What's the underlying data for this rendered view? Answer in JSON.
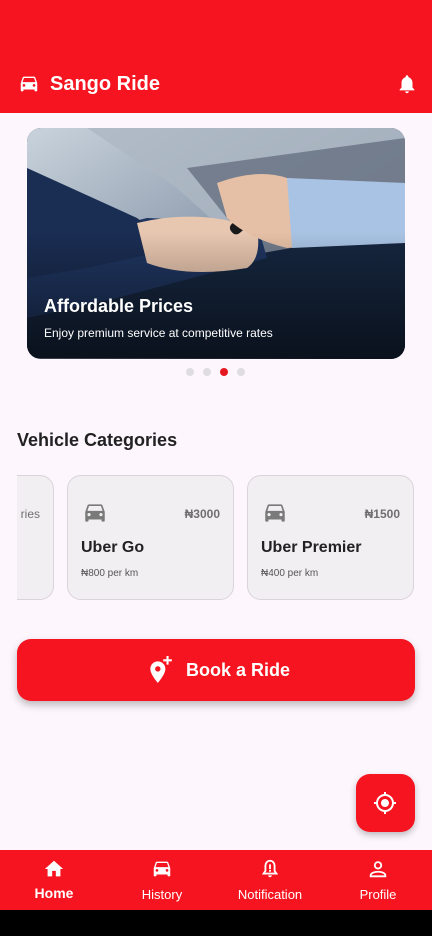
{
  "app": {
    "title": "Sango Ride"
  },
  "colors": {
    "primary": "#f5141f",
    "background": "#fdf6fc",
    "card": "#f2eff3",
    "dot_active": "#e51822",
    "dot_inactive": "#dfdde1"
  },
  "header": {
    "logo_icon": "car-icon",
    "notification_icon": "bell-icon"
  },
  "banner": {
    "title": "Affordable Prices",
    "subtitle": "Enjoy premium service at competitive rates",
    "slide_count": 4,
    "active_slide": 3
  },
  "categories": {
    "heading": "Vehicle Categories",
    "partial_label": "ries",
    "items": [
      {
        "name": "Uber Go",
        "price": "₦3000",
        "rate": "₦800 per km",
        "icon": "car-icon"
      },
      {
        "name": "Uber Premier",
        "price": "₦1500",
        "rate": "₦400 per km",
        "icon": "car-icon"
      }
    ]
  },
  "book": {
    "label": "Book a Ride",
    "icon": "add-location-icon"
  },
  "fab": {
    "icon": "my-location-icon"
  },
  "nav": {
    "items": [
      {
        "label": "Home",
        "icon": "home-icon",
        "active": true
      },
      {
        "label": "History",
        "icon": "car-icon",
        "active": false
      },
      {
        "label": "Notification",
        "icon": "notification-alert-icon",
        "active": false
      },
      {
        "label": "Profile",
        "icon": "person-icon",
        "active": false
      }
    ]
  }
}
